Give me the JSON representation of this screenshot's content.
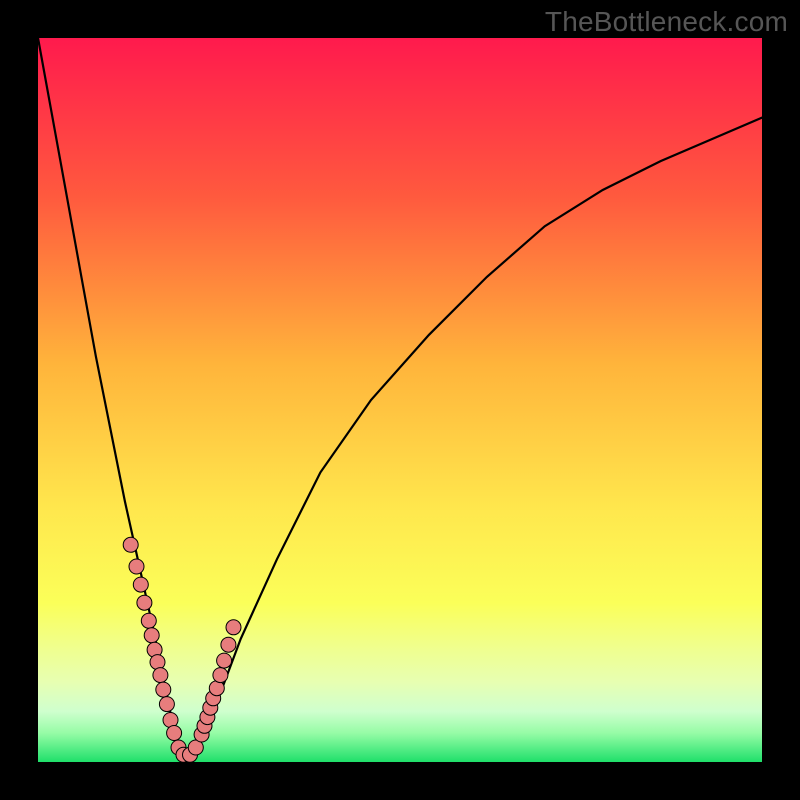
{
  "watermark": {
    "text": "TheBottleneck.com"
  },
  "colors": {
    "frame": "#000000",
    "curve": "#000000",
    "marker_fill": "#e77d7d",
    "marker_stroke": "#000000",
    "gradient_stops": [
      {
        "pct": 0,
        "hex": "#ff1a4d"
      },
      {
        "pct": 22,
        "hex": "#ff5a3e"
      },
      {
        "pct": 45,
        "hex": "#ffb43b"
      },
      {
        "pct": 65,
        "hex": "#ffe74d"
      },
      {
        "pct": 78,
        "hex": "#fbff59"
      },
      {
        "pct": 84,
        "hex": "#f0ff8c"
      },
      {
        "pct": 89,
        "hex": "#e7ffb2"
      },
      {
        "pct": 93,
        "hex": "#cfffce"
      },
      {
        "pct": 96,
        "hex": "#96fca6"
      },
      {
        "pct": 100,
        "hex": "#1fe06a"
      }
    ]
  },
  "chart_data": {
    "type": "line",
    "title": "",
    "xlabel": "",
    "ylabel": "",
    "xlim": [
      0,
      100
    ],
    "ylim": [
      0,
      100
    ],
    "grid": false,
    "legend": false,
    "series": [
      {
        "name": "bottleneck-curve",
        "x": [
          0,
          2,
          4,
          6,
          8,
          10,
          12,
          14,
          16,
          17,
          18,
          19,
          19.4,
          20,
          21,
          22,
          23.5,
          25,
          28,
          33,
          39,
          46,
          54,
          62,
          70,
          78,
          86,
          93,
          100
        ],
        "y": [
          100,
          89,
          78,
          67,
          56,
          46,
          36,
          27,
          18,
          13,
          8,
          4,
          2,
          1,
          1,
          2,
          5,
          9,
          17,
          28,
          40,
          50,
          59,
          67,
          74,
          79,
          83,
          86,
          89
        ]
      }
    ],
    "markers": {
      "name": "cluster-points",
      "x": [
        12.8,
        13.6,
        14.2,
        14.7,
        15.3,
        15.7,
        16.1,
        16.5,
        16.9,
        17.3,
        17.8,
        18.3,
        18.8,
        19.4,
        20.1,
        21.0,
        21.8,
        22.6,
        23.0,
        23.4,
        23.8,
        24.2,
        24.7,
        25.2,
        25.7,
        26.3,
        27.0
      ],
      "y": [
        30.0,
        27.0,
        24.5,
        22.0,
        19.5,
        17.5,
        15.5,
        13.8,
        12.0,
        10.0,
        8.0,
        5.8,
        4.0,
        2.0,
        1.0,
        1.0,
        2.0,
        3.8,
        5.0,
        6.2,
        7.5,
        8.8,
        10.2,
        12.0,
        14.0,
        16.2,
        18.6
      ]
    }
  }
}
